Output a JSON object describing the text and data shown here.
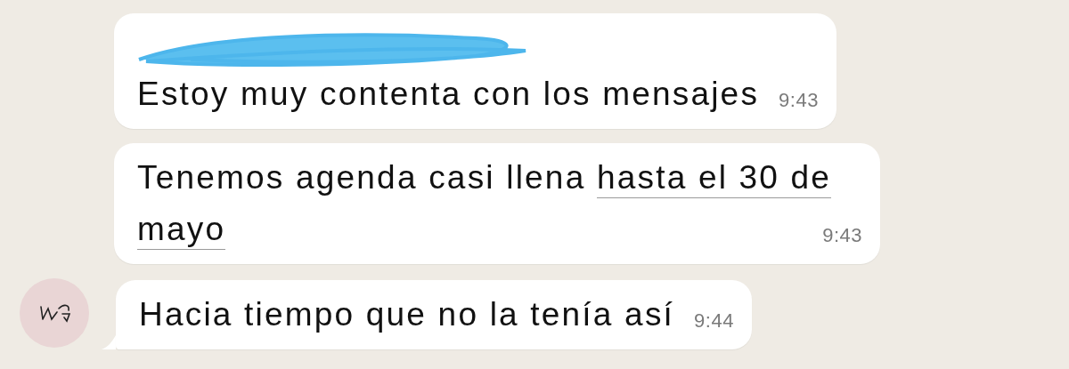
{
  "messages": [
    {
      "sender_hidden": true,
      "avatar": false,
      "text": "Estoy muy contenta con los mensajes",
      "time": "9:43"
    },
    {
      "sender_hidden": false,
      "avatar": false,
      "text": "Tenemos agenda casi llena ",
      "link_parts": [
        "hasta el 30 de",
        "mayo"
      ],
      "time": "9:43"
    },
    {
      "sender_hidden": false,
      "avatar": true,
      "text": "Hacia tiempo que no la tenía así",
      "time": "9:44"
    }
  ]
}
